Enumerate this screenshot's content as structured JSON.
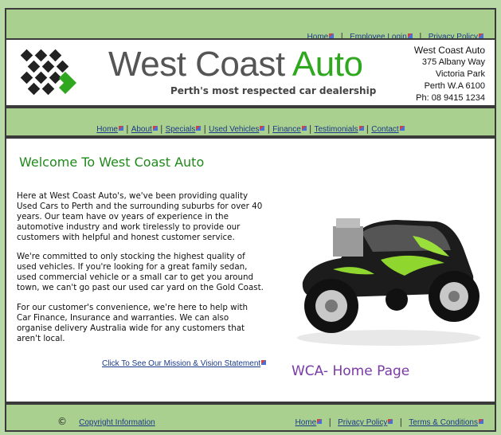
{
  "top_nav": {
    "items": [
      {
        "label": "Home"
      },
      {
        "label": "Employee Login"
      },
      {
        "label": "Privacy Policy"
      }
    ]
  },
  "header": {
    "brand_main": "West Coast ",
    "brand_accent": "Auto",
    "tagline": "Perth's most respected car dealership",
    "address": {
      "name": "West Coast Auto",
      "line1": "375 Albany Way",
      "line2": "Victoria Park",
      "line3": "Perth  W.A 6100",
      "phone": "Ph: 08 9415 1234"
    }
  },
  "main_nav": {
    "items": [
      {
        "label": "Home"
      },
      {
        "label": "About"
      },
      {
        "label": "Specials"
      },
      {
        "label": "Used Vehicles"
      },
      {
        "label": "Finance"
      },
      {
        "label": "Testimonials"
      },
      {
        "label": "Contact"
      }
    ]
  },
  "content": {
    "title": "Welcome To West Coast Auto",
    "paragraphs": [
      "Here at West Coast Auto's, we've been providing quality Used Cars to Perth and the surrounding suburbs for over 40 years. Our team have ov years of experience in the automotive industry and work tirelessly to provide our customers with helpful and honest customer service.",
      "We're committed to only stocking the highest quality of used vehicles. If you're looking for a great family sedan, used commercial vehicle or a small car to get you around town, we can't go past our used car yard on the Gold Coast.",
      "For our customer's convenience, we're here to help with Car Finance, Insurance and warranties. We can also organise delivery Australia wide for any customers that aren't local."
    ],
    "mission_link": "Click To See Our Mission & Vision Statement",
    "caption": "WCA- Home Page"
  },
  "footer": {
    "copyright_symbol": "©",
    "copyright_link": "Copyright Information",
    "links": [
      {
        "label": "Home"
      },
      {
        "label": "Privacy Policy"
      },
      {
        "label": "Terms & Conditions"
      }
    ]
  },
  "colors": {
    "band_green": "#a9d08e",
    "brand_green": "#2fa820",
    "title_green": "#1f8a1a",
    "link_blue": "#1b3a8a",
    "caption_purple": "#7a3aa6"
  }
}
